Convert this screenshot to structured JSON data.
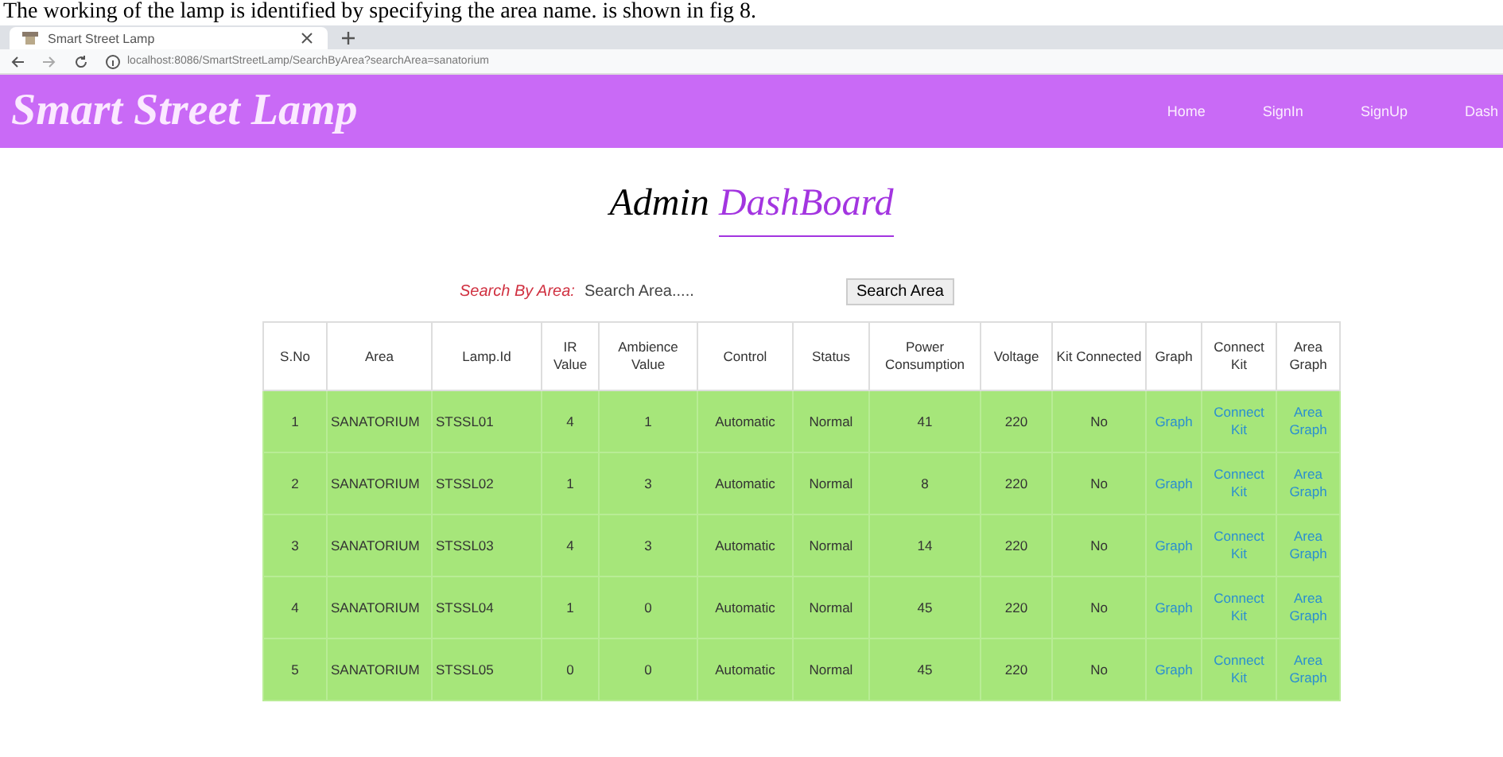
{
  "caption": "The working of the lamp is identified by specifying the area name. is shown in fig 8.",
  "browser": {
    "tab_title": "Smart Street Lamp",
    "address": "localhost:8086/SmartStreetLamp/SearchByArea?searchArea=sanatorium"
  },
  "header": {
    "brand": "Smart Street Lamp",
    "nav": [
      "Home",
      "SignIn",
      "SignUp",
      "Dash"
    ]
  },
  "heading": {
    "prefix": "Admin",
    "highlight": "DashBoard"
  },
  "search": {
    "label": "Search By Area:",
    "placeholder": "Search Area.....",
    "button": "Search Area"
  },
  "table": {
    "columns": [
      "S.No",
      "Area",
      "Lamp.Id",
      "IR Value",
      "Ambience Value",
      "Control",
      "Status",
      "Power Consumption",
      "Voltage",
      "Kit Connected",
      "Graph",
      "Connect Kit",
      "Area Graph"
    ],
    "rows": [
      [
        "1",
        "SANATORIUM",
        "STSSL01",
        "4",
        "1",
        "Automatic",
        "Normal",
        "41",
        "220",
        "No",
        "Graph",
        "Connect Kit",
        "Area Graph"
      ],
      [
        "2",
        "SANATORIUM",
        "STSSL02",
        "1",
        "3",
        "Automatic",
        "Normal",
        "8",
        "220",
        "No",
        "Graph",
        "Connect Kit",
        "Area Graph"
      ],
      [
        "3",
        "SANATORIUM",
        "STSSL03",
        "4",
        "3",
        "Automatic",
        "Normal",
        "14",
        "220",
        "No",
        "Graph",
        "Connect Kit",
        "Area Graph"
      ],
      [
        "4",
        "SANATORIUM",
        "STSSL04",
        "1",
        "0",
        "Automatic",
        "Normal",
        "45",
        "220",
        "No",
        "Graph",
        "Connect Kit",
        "Area Graph"
      ],
      [
        "5",
        "SANATORIUM",
        "STSSL05",
        "0",
        "0",
        "Automatic",
        "Normal",
        "45",
        "220",
        "No",
        "Graph",
        "Connect Kit",
        "Area Graph"
      ]
    ]
  }
}
